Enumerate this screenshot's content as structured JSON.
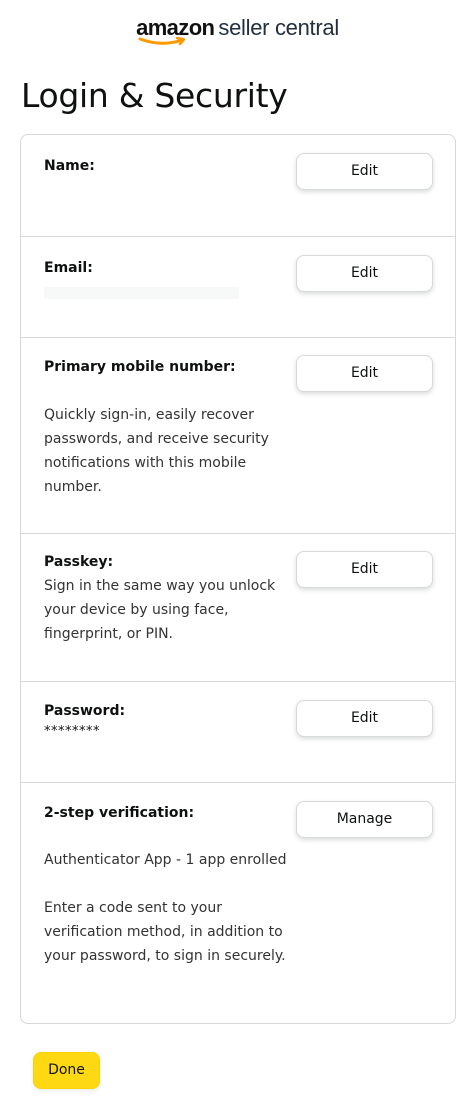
{
  "header": {
    "logo_brand": "amazon",
    "logo_product": "seller central"
  },
  "page": {
    "title": "Login & Security"
  },
  "sections": {
    "name": {
      "label": "Name:",
      "button": "Edit"
    },
    "email": {
      "label": "Email:",
      "button": "Edit"
    },
    "mobile": {
      "label": "Primary mobile number:",
      "description": "Quickly sign-in, easily recover passwords, and receive security notifications with this mobile number.",
      "button": "Edit"
    },
    "passkey": {
      "label": "Passkey:",
      "description": "Sign in the same way you unlock your device by using face, fingerprint, or PIN.",
      "button": "Edit"
    },
    "password": {
      "label": "Password:",
      "value": "********",
      "button": "Edit"
    },
    "two_step": {
      "label": "2-step verification:",
      "status": "Authenticator App - 1 app enrolled",
      "description": "Enter a code sent to your verification method, in addition to your password, to sign in securely.",
      "button": "Manage"
    }
  },
  "footer": {
    "done_label": "Done"
  },
  "colors": {
    "primary_button": "#ffd814",
    "border": "#d5d9d9",
    "text": "#0f1111",
    "logo_smile": "#ff9900"
  }
}
